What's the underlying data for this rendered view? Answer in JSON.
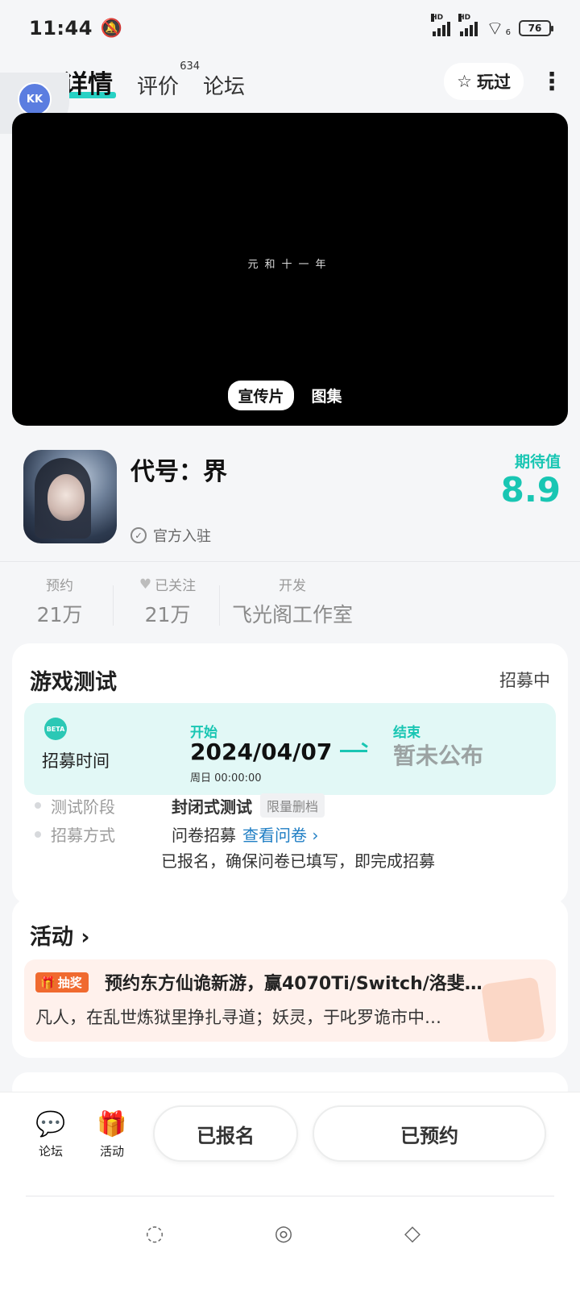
{
  "status_bar": {
    "time": "11:44",
    "signal_label_1": "HD",
    "signal_label_2": "HD",
    "wifi_sub": "6",
    "battery": "76"
  },
  "header": {
    "tabs": [
      {
        "label": "详情",
        "active": true
      },
      {
        "label": "评价",
        "count": "634"
      },
      {
        "label": "论坛"
      }
    ],
    "played_label": "玩过"
  },
  "float_badge": "KK",
  "video": {
    "caption": "元和十一年",
    "media_tabs": [
      "宣传片",
      "图集"
    ]
  },
  "game": {
    "title": "代号：界",
    "verified": "官方入驻",
    "expect_label": "期待值",
    "expect_value": "8.9"
  },
  "stats": [
    {
      "label": "预约",
      "value": "21万"
    },
    {
      "label": "已关注",
      "value": "21万"
    },
    {
      "label": "开发",
      "value": "飞光阁工作室"
    }
  ],
  "test_card": {
    "title": "游戏测试",
    "status": "招募中",
    "beta_text": "BETA",
    "recruit_label": "招募时间",
    "start_label": "开始",
    "start_date": "2024/04/07",
    "start_sub": "周日 00:00:00",
    "end_label": "结束",
    "end_value": "暂未公布",
    "stage_label": "测试阶段",
    "stage_value": "封闭式测试",
    "stage_tag": "限量删档",
    "method_label": "招募方式",
    "method_value": "问卷招募",
    "method_link": "查看问卷",
    "note": "已报名，确保问卷已填写，即完成招募"
  },
  "activity_card": {
    "title": "活动",
    "tag": "抽奖",
    "item_title": "预约东方仙诡新游，赢4070Ti/Switch/洛斐…",
    "item_desc": "凡人，在乱世炼狱里挣扎寻道；妖灵，于叱罗诡市中…"
  },
  "bottom_bar": {
    "forum_label": "论坛",
    "activity_label": "活动",
    "registered_label": "已报名",
    "reserved_label": "已预约"
  },
  "colors": {
    "accent": "#19c6b3",
    "tab_highlight": "#27d1c4",
    "orange": "#f06a2f",
    "link": "#1f7ec4"
  }
}
